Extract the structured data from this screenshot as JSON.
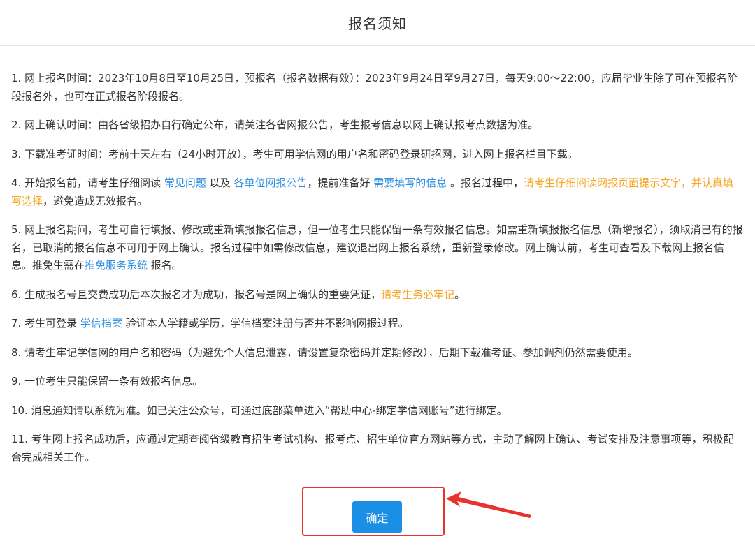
{
  "header": {
    "title": "报名须知"
  },
  "items": [
    {
      "text": "1. 网上报名时间：2023年10月8日至10月25日，预报名（报名数据有效）：2023年9月24日至9月27日，每天9:00～22:00，应届毕业生除了可在预报名阶段报名外，也可在正式报名阶段报名。"
    },
    {
      "text": "2. 网上确认时间：由各省级招办自行确定公布，请关注各省网报公告，考生报考信息以网上确认报考点数据为准。"
    },
    {
      "text": "3. 下载准考证时间：考前十天左右（24小时开放），考生可用学信网的用户名和密码登录研招网，进入网上报名栏目下载。"
    },
    {
      "p1": "4. 开始报名前，请考生仔细阅读 ",
      "link1": "常见问题",
      "p2": " 以及 ",
      "link2": "各单位网报公告",
      "p3": "，提前准备好 ",
      "link3": "需要填写的信息",
      "p4": " 。报名过程中，",
      "warn": "请考生仔细阅读网报页面提示文字，并认真填写选择",
      "p5": "，避免造成无效报名。"
    },
    {
      "p1": "5. 网上报名期间，考生可自行填报、修改或重新填报报名信息，但一位考生只能保留一条有效报名信息。如需重新填报报名信息（新增报名），须取消已有的报名，已取消的报名信息不可用于网上确认。报名过程中如需修改信息，建议退出网上报名系统，重新登录修改。网上确认前，考生可查看及下载网上报名信息。推免生需在",
      "link1": "推免服务系统",
      "p2": " 报名。"
    },
    {
      "p1": "6. 生成报名号且交费成功后本次报名才为成功，报名号是网上确认的重要凭证，",
      "warn": "请考生务必牢记",
      "p2": "。"
    },
    {
      "p1": "7. 考生可登录 ",
      "link1": "学信档案",
      "p2": " 验证本人学籍或学历，学信档案注册与否并不影响网报过程。"
    },
    {
      "text": "8. 请考生牢记学信网的用户名和密码（为避免个人信息泄露，请设置复杂密码并定期修改），后期下载准考证、参加调剂仍然需要使用。"
    },
    {
      "text": "9. 一位考生只能保留一条有效报名信息。"
    },
    {
      "text": "10. 消息通知请以系统为准。如已关注公众号，可通过底部菜单进入“帮助中心-绑定学信网账号”进行绑定。"
    },
    {
      "text": "11. 考生网上报名成功后，应通过定期查阅省级教育招生考试机构、报考点、招生单位官方网站等方式，主动了解网上确认、考试安排及注意事项等，积极配合完成相关工作。"
    }
  ],
  "footer": {
    "confirm_label": "确定"
  },
  "colors": {
    "link": "#2f8fe0",
    "warning": "#f5a623",
    "primary_button": "#1b8fe6",
    "annotation": "#e8322e"
  }
}
